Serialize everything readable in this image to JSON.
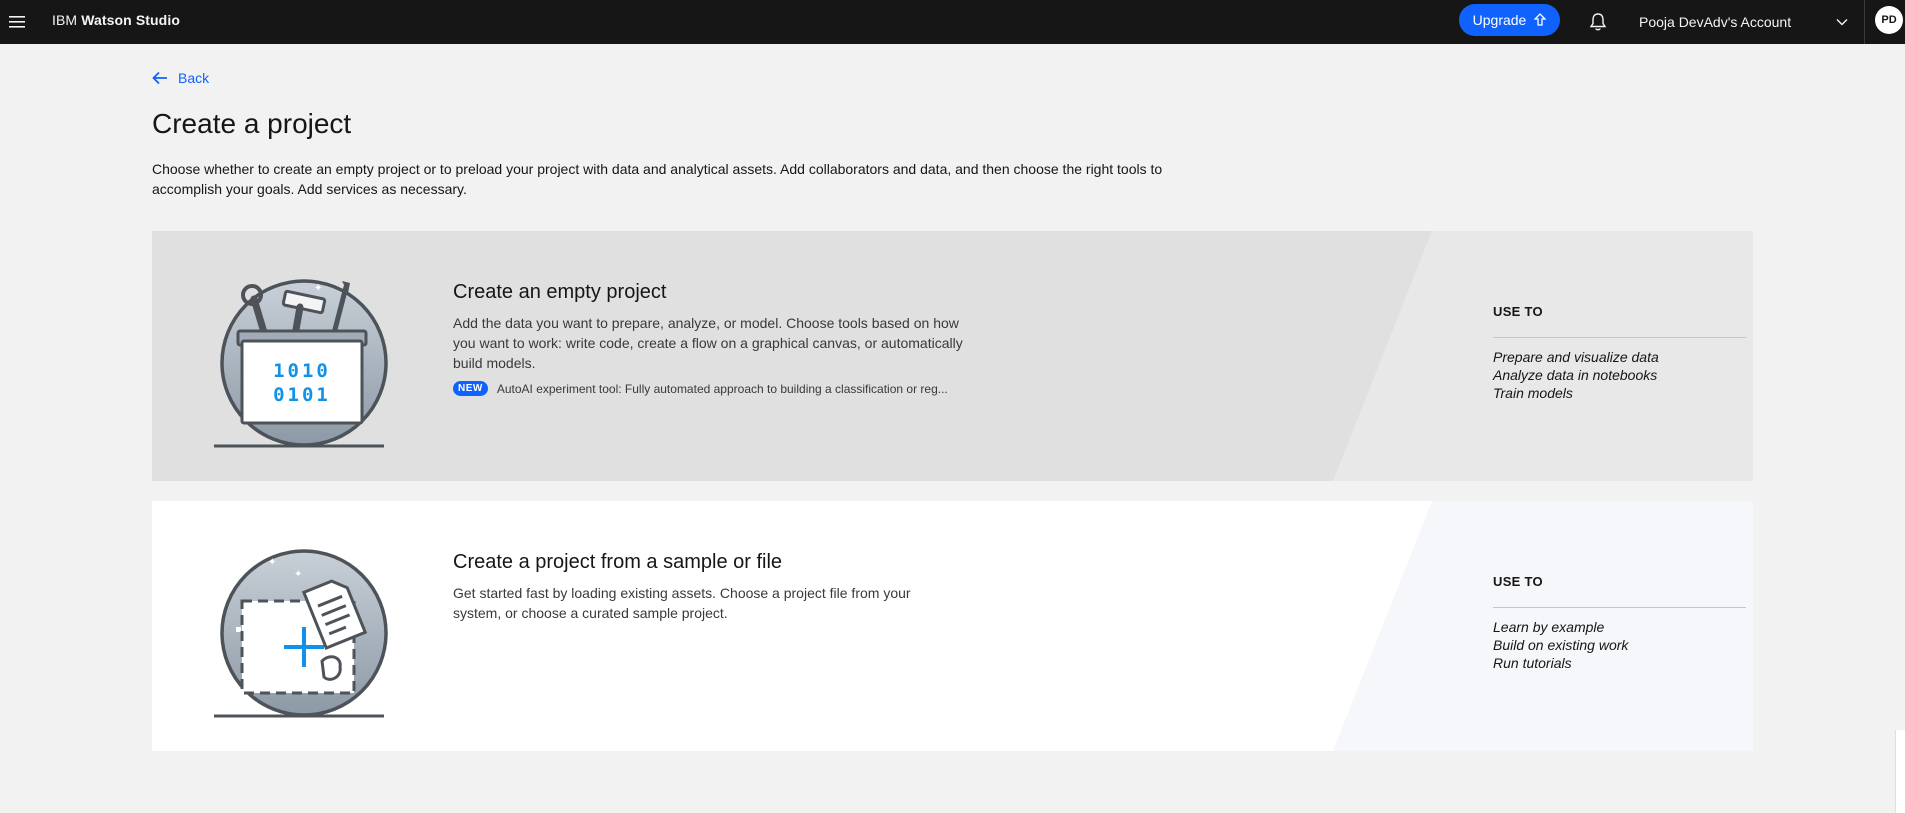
{
  "header": {
    "brand_prefix": "IBM",
    "brand_name": "Watson Studio",
    "upgrade_label": "Upgrade",
    "account_name": "Pooja DevAdv's Account",
    "avatar_initials": "PD"
  },
  "nav": {
    "back_label": "Back"
  },
  "page": {
    "title": "Create a project",
    "description": "Choose whether to create an empty project or to preload your project with data and analytical assets. Add collaborators and data, and then choose the right tools to accomplish your goals. Add services as necessary."
  },
  "cards": [
    {
      "title": "Create an empty project",
      "description": "Add the data you want to prepare, analyze, or model. Choose tools based on how you want to work: write code, create a flow on a graphical canvas, or automatically build models.",
      "badge": "NEW",
      "badge_text": "AutoAI experiment tool: Fully automated approach to building a classification or reg...",
      "use_to_title": "USE TO",
      "use_to_items": [
        "Prepare and visualize data",
        "Analyze data in notebooks",
        "Train models"
      ]
    },
    {
      "title": "Create a project from a sample or file",
      "description": "Get started fast by loading existing assets. Choose a project file from your system, or choose a curated sample project.",
      "use_to_title": "USE TO",
      "use_to_items": [
        "Learn by example",
        "Build on existing work",
        "Run tutorials"
      ]
    }
  ],
  "illustration_text": {
    "binary_line_1": "1010",
    "binary_line_2": "0101"
  },
  "colors": {
    "header_bg": "#161616",
    "accent": "#0f62fe",
    "teal": "#1192e8",
    "card1_bg": "#e0e0e0",
    "card2_bg": "#ffffff"
  }
}
